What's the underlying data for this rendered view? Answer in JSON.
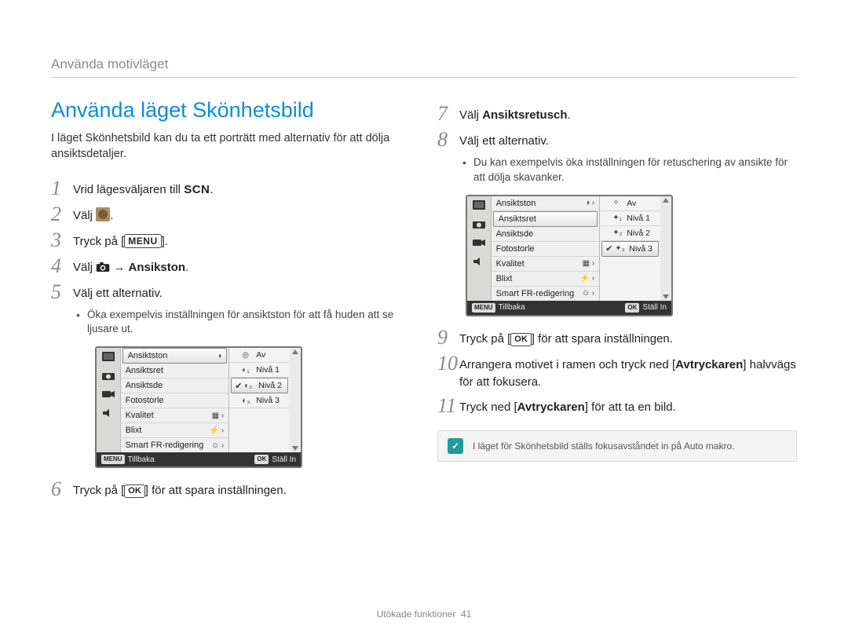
{
  "breadcrumb": "Använda motivläget",
  "title": "Använda läget Skönhetsbild",
  "intro": "I läget Skönhetsbild kan du ta ett porträtt med alternativ för att dölja ansiktsdetaljer.",
  "footer": {
    "label": "Utökade funktioner",
    "page": "41"
  },
  "left": {
    "steps": {
      "s1": {
        "prefix": "Vrid lägesväljaren till",
        "scn": "SCN",
        "suffix": "."
      },
      "s2": {
        "prefix": "Välj",
        "suffix": "."
      },
      "s3": {
        "prefix": "Tryck på [",
        "menu": "MENU",
        "suffix": "]."
      },
      "s4": {
        "prefix": "Välj",
        "arrow": " → ",
        "target": "Ansikston",
        "suffix": "."
      },
      "s5": {
        "text": "Välj ett alternativ."
      },
      "s5_sub": "Öka exempelvis inställningen för ansiktston för att få huden att se ljusare ut.",
      "s6": {
        "prefix": "Tryck på [",
        "ok": "OK",
        "suffix": "] för att spara inställningen."
      }
    }
  },
  "right": {
    "steps": {
      "s7": {
        "prefix": "Välj ",
        "bold": "Ansiktsretusch",
        "suffix": "."
      },
      "s8": {
        "text": "Välj ett alternativ."
      },
      "s8_sub": "Du kan exempelvis öka inställningen för retuschering av ansikte för att dölja skavanker.",
      "s9": {
        "prefix": "Tryck på [",
        "ok": "OK",
        "suffix": "] för att spara inställningen."
      },
      "s10": {
        "prefix": "Arrangera motivet i ramen och tryck ned [",
        "bold": "Avtryckaren",
        "suffix": "] halvvägs för att fokusera."
      },
      "s11": {
        "prefix": "Tryck ned [",
        "bold": "Avtryckaren",
        "suffix": "] för att ta en bild."
      }
    },
    "note": "I läget för Skönhetsbild ställs fokusavståndet in på Auto makro."
  },
  "lcd1": {
    "menu": [
      "Ansiktston",
      "Ansiktsret",
      "Ansiktsde",
      "Fotostorle",
      "Kvalitet",
      "Blixt",
      "Smart FR-redigering"
    ],
    "selectedMenu": 0,
    "options": [
      "Av",
      "Nivå 1",
      "Nivå 2",
      "Nivå 3"
    ],
    "selectedOption": 2,
    "footer": {
      "back": "Tillbaka",
      "backKey": "MENU",
      "set": "Ställ In",
      "setKey": "OK"
    }
  },
  "lcd2": {
    "menu": [
      "Ansiktston",
      "Ansiktsret",
      "Ansiktsde",
      "Fotostorle",
      "Kvalitet",
      "Blixt",
      "Smart FR-redigering"
    ],
    "selectedMenu": 1,
    "options": [
      "Av",
      "Nivå 1",
      "Nivå 2",
      "Nivå 3"
    ],
    "selectedOption": 3,
    "footer": {
      "back": "Tillbaka",
      "backKey": "MENU",
      "set": "Ställ In",
      "setKey": "OK"
    }
  },
  "note_icon": "✓"
}
